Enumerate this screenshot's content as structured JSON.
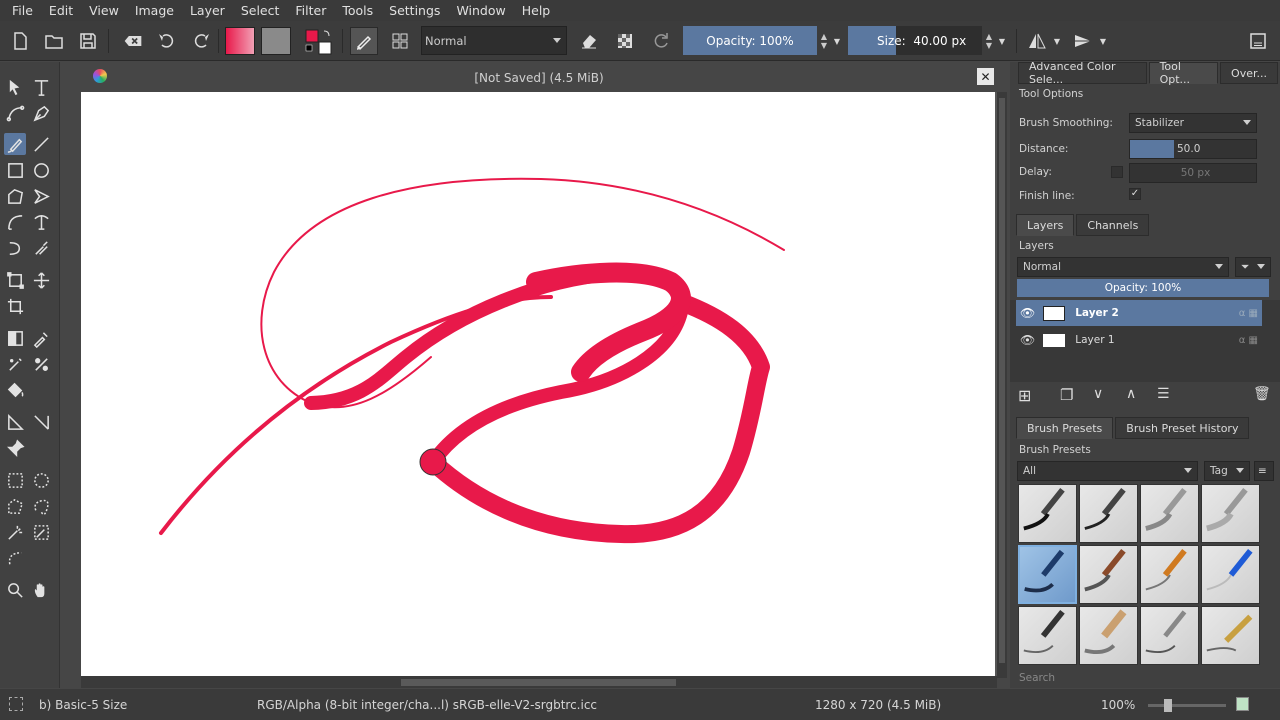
{
  "menu": [
    "File",
    "Edit",
    "View",
    "Image",
    "Layer",
    "Select",
    "Filter",
    "Tools",
    "Settings",
    "Window",
    "Help"
  ],
  "toolbar": {
    "blend_mode": "Normal",
    "opacity_label": "Opacity:  100%",
    "size_label": "Size:",
    "size_value": "40.00 px"
  },
  "document": {
    "title": "[Not Saved]  (4.5 MiB)"
  },
  "right_panel": {
    "top_tabs": [
      "Advanced Color Sele...",
      "Tool Opt...",
      "Over..."
    ],
    "tool_options_title": "Tool Options",
    "brush_smoothing_label": "Brush Smoothing:",
    "brush_smoothing_value": "Stabilizer",
    "distance_label": "Distance:",
    "distance_value": "50.0",
    "distance_fraction": 0.35,
    "delay_label": "Delay:",
    "delay_value": "50 px",
    "finish_line_label": "Finish line:",
    "layer_tabs": [
      "Layers",
      "Channels"
    ],
    "layers_title": "Layers",
    "layers_blend": "Normal",
    "layers_opacity": "Opacity:  100%",
    "layers": [
      {
        "name": "Layer 2",
        "selected": true
      },
      {
        "name": "Layer 1",
        "selected": false
      }
    ],
    "preset_tabs": [
      "Brush Presets",
      "Brush Preset History"
    ],
    "presets_title": "Brush Presets",
    "presets_filter": "All",
    "presets_tag": "Tag",
    "search_placeholder": "Search"
  },
  "status": {
    "brush": "b) Basic-5 Size",
    "color_space": "RGB/Alpha (8-bit integer/cha...l)  sRGB-elle-V2-srgbtrc.icc",
    "dimensions": "1280 x 720 (4.5 MiB)",
    "zoom": "100%"
  },
  "colors": {
    "stroke": "#e8194a",
    "accent": "#5b78a0"
  }
}
